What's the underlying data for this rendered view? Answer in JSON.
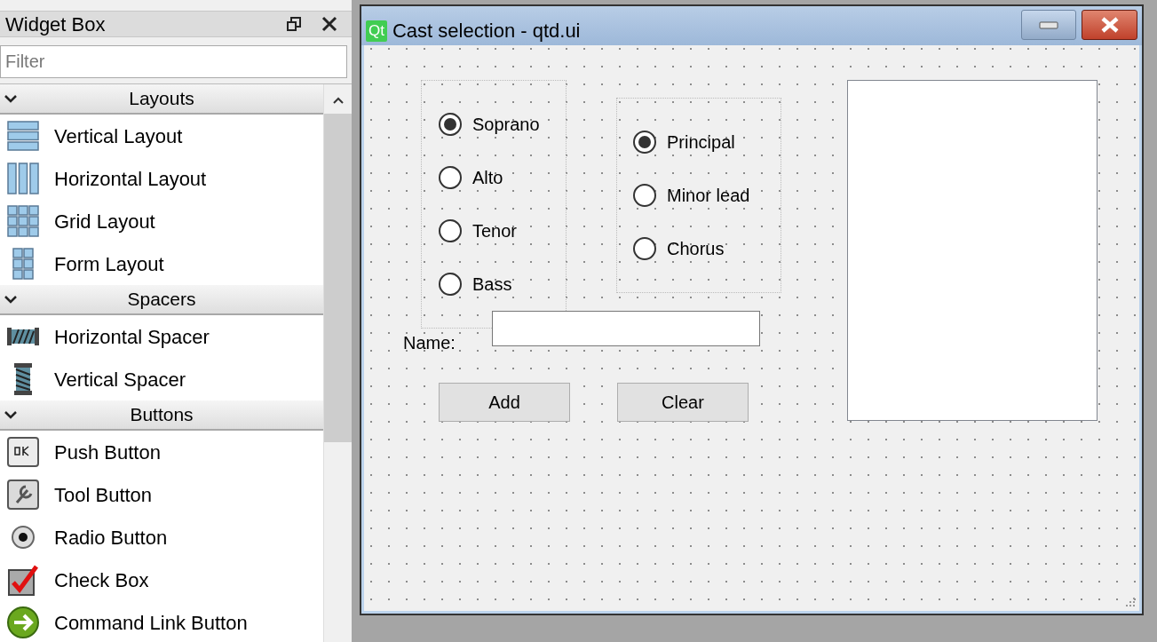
{
  "widget_box": {
    "title": "Widget Box",
    "filter": {
      "placeholder": "Filter"
    },
    "categories": [
      {
        "name": "Layouts",
        "expanded": true,
        "items": [
          {
            "label": "Vertical Layout",
            "kind": "vlayout"
          },
          {
            "label": "Horizontal Layout",
            "kind": "hlayout"
          },
          {
            "label": "Grid Layout",
            "kind": "grid"
          },
          {
            "label": "Form Layout",
            "kind": "form"
          }
        ]
      },
      {
        "name": "Spacers",
        "expanded": true,
        "items": [
          {
            "label": "Horizontal Spacer",
            "kind": "hspacer"
          },
          {
            "label": "Vertical Spacer",
            "kind": "vspacer"
          }
        ]
      },
      {
        "name": "Buttons",
        "expanded": true,
        "items": [
          {
            "label": "Push Button",
            "kind": "push"
          },
          {
            "label": "Tool Button",
            "kind": "tool"
          },
          {
            "label": "Radio Button",
            "kind": "radio"
          },
          {
            "label": "Check Box",
            "kind": "check"
          },
          {
            "label": "Command Link Button",
            "kind": "commandlink"
          }
        ]
      }
    ]
  },
  "form_window": {
    "badge": "Qt",
    "title": "Cast selection - qtd.ui",
    "voice_group": [
      {
        "label": "Soprano",
        "selected": true
      },
      {
        "label": "Alto",
        "selected": false
      },
      {
        "label": "Tenor",
        "selected": false
      },
      {
        "label": "Bass",
        "selected": false
      }
    ],
    "role_group": [
      {
        "label": "Principal",
        "selected": true
      },
      {
        "label": "Minor lead",
        "selected": false
      },
      {
        "label": "Chorus",
        "selected": false
      }
    ],
    "name_label": "Name:",
    "buttons": [
      "Add",
      "Clear"
    ]
  }
}
